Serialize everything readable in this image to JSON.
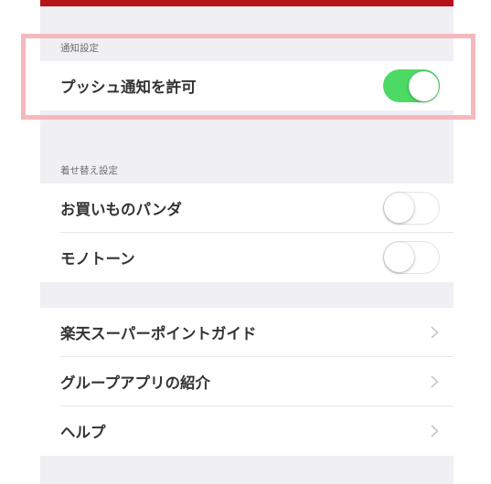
{
  "colors": {
    "top_bar": "#b5121b",
    "page_background": "#efeff4",
    "toggle_on": "#4cd964",
    "highlight": "#f5b8bc"
  },
  "notification_section": {
    "header": "通知設定",
    "rows": [
      {
        "label": "プッシュ通知を許可",
        "control": "toggle",
        "on": true
      }
    ]
  },
  "skin_section": {
    "header": "着せ替え設定",
    "rows": [
      {
        "label": "お買いものパンダ",
        "control": "toggle",
        "on": false
      },
      {
        "label": "モノトーン",
        "control": "toggle",
        "on": false
      }
    ]
  },
  "links_section": {
    "rows": [
      {
        "label": "楽天スーパーポイントガイド",
        "icon": "chevron-right-icon"
      },
      {
        "label": "グループアプリの紹介",
        "icon": "chevron-right-icon"
      },
      {
        "label": "ヘルプ",
        "icon": "chevron-right-icon"
      }
    ]
  }
}
